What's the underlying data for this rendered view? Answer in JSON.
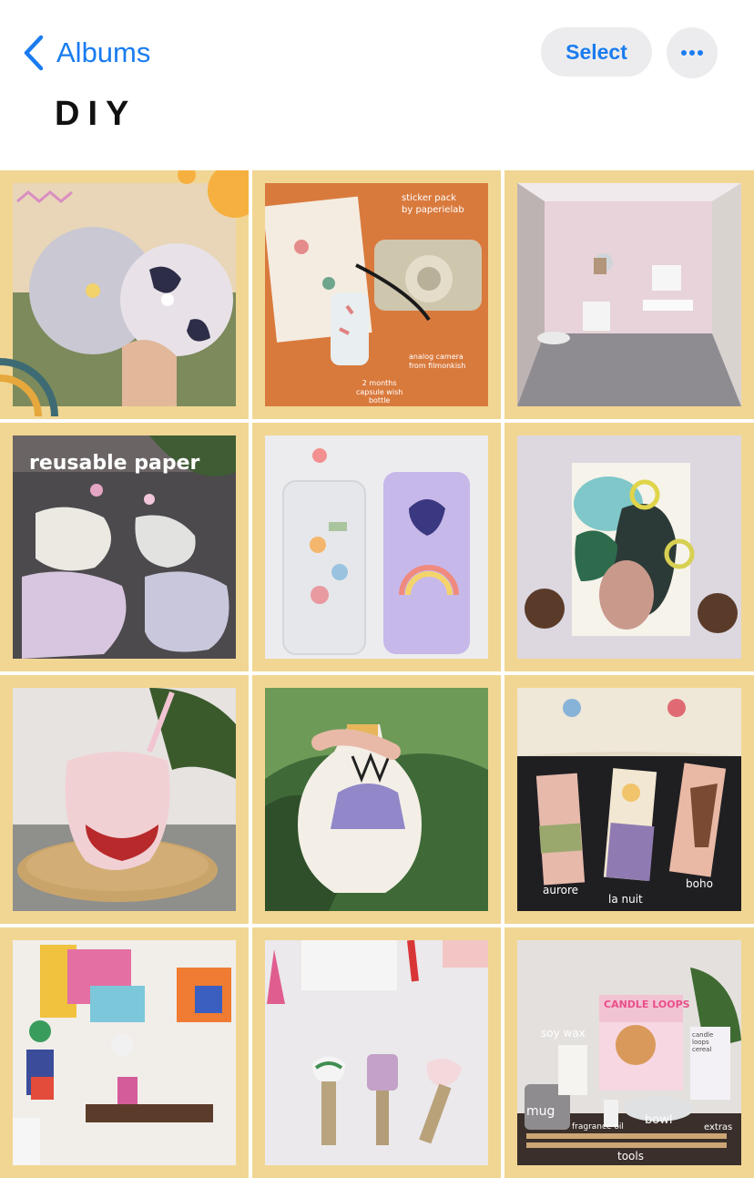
{
  "nav": {
    "back_label": "Albums",
    "select_label": "Select"
  },
  "album": {
    "title": "DIY"
  },
  "colors": {
    "accent": "#1a7cf0",
    "frame": "#f1d693"
  },
  "photos": {
    "p2": {
      "caption_sticker": "sticker pack\nby paperielab",
      "caption_camera": "analog camera\nfrom filmonkish",
      "caption_capsule": "2 months\ncapsule wish\nbottle"
    },
    "p4": {
      "caption": "reusable paper"
    },
    "p9": {
      "tag1": "aurore",
      "tag2": "la nuit",
      "tag3": "boho"
    },
    "p12": {
      "soy": "soy wax",
      "mug": "mug",
      "fragrance": "fragrance oil",
      "bowl": "bowl",
      "tools": "tools",
      "extras": "extras",
      "box": "CANDLE LOOPS",
      "box2": "candle loops cereal"
    }
  }
}
